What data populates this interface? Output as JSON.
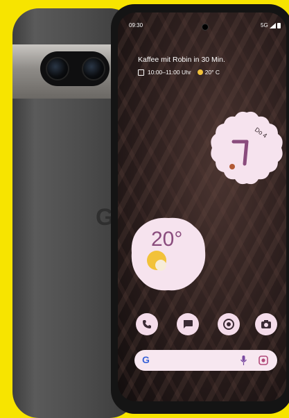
{
  "status_bar": {
    "time": "09:30",
    "network": "5G"
  },
  "glance": {
    "event": "Kaffee mit Robin in 30 Min.",
    "time_range": "10:00–11:00 Uhr",
    "temperature": "20° C"
  },
  "clock_widget": {
    "date": "Do 4"
  },
  "weather_widget": {
    "temperature": "20°"
  },
  "dock": [
    {
      "name": "phone-icon"
    },
    {
      "name": "messages-icon"
    },
    {
      "name": "chrome-icon"
    },
    {
      "name": "camera-icon"
    }
  ],
  "search_bar": {
    "logo": "G"
  },
  "device_back": {
    "logo": "G"
  },
  "colors": {
    "background": "#f7e400",
    "widget_pink": "#f4dcea",
    "accent_purple": "#8a4c7d"
  }
}
